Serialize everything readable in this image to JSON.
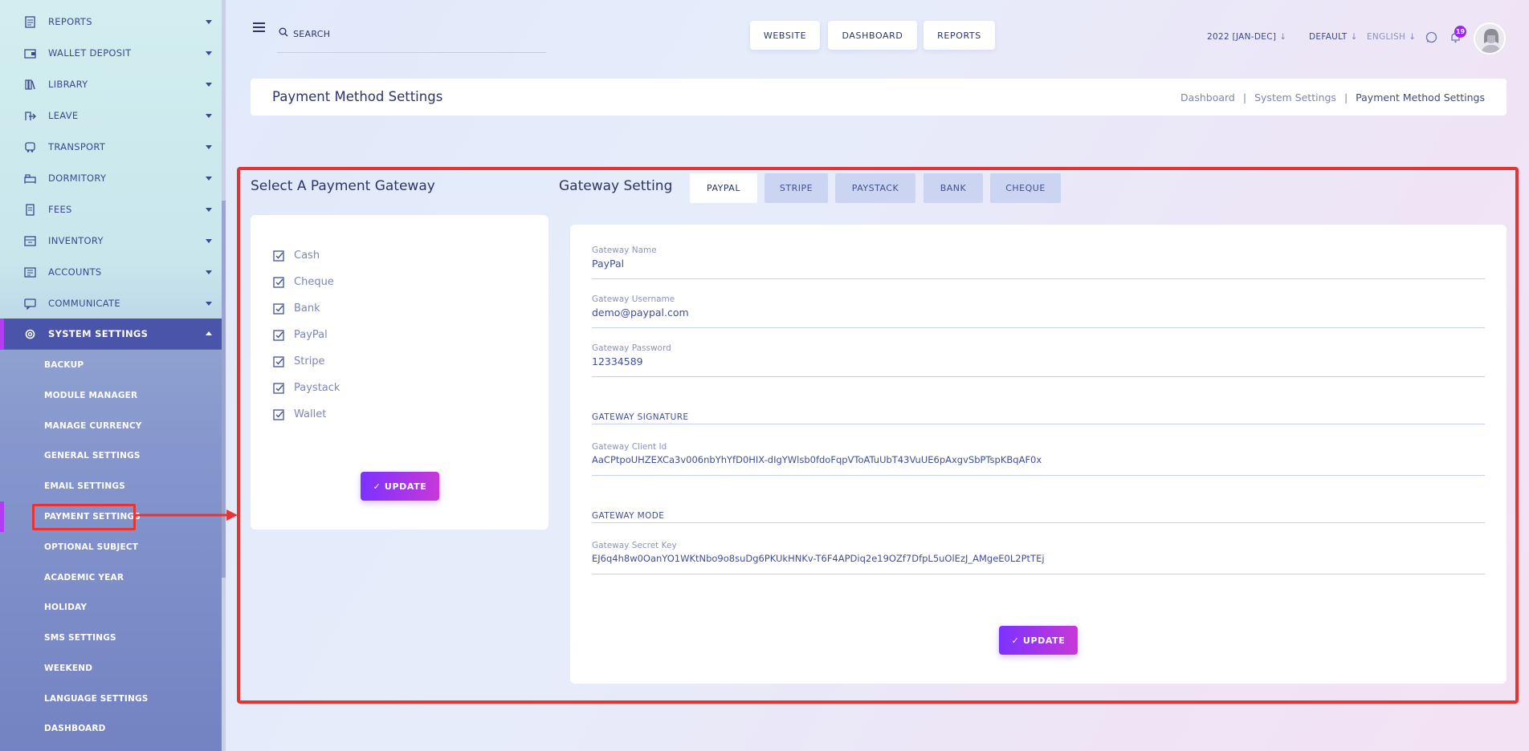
{
  "sidebar": {
    "items": [
      {
        "label": "REPORTS",
        "icon": "report-icon"
      },
      {
        "label": "WALLET DEPOSIT",
        "icon": "wallet-icon"
      },
      {
        "label": "LIBRARY",
        "icon": "library-icon"
      },
      {
        "label": "LEAVE",
        "icon": "leave-icon"
      },
      {
        "label": "TRANSPORT",
        "icon": "transport-icon"
      },
      {
        "label": "DORMITORY",
        "icon": "dormitory-icon"
      },
      {
        "label": "FEES",
        "icon": "fees-icon"
      },
      {
        "label": "INVENTORY",
        "icon": "inventory-icon"
      },
      {
        "label": "ACCOUNTS",
        "icon": "accounts-icon"
      },
      {
        "label": "COMMUNICATE",
        "icon": "communicate-icon"
      },
      {
        "label": "SYSTEM SETTINGS",
        "icon": "gear-icon"
      }
    ],
    "submenu": [
      "BACKUP",
      "MODULE MANAGER",
      "MANAGE CURRENCY",
      "GENERAL SETTINGS",
      "EMAIL SETTINGS",
      "PAYMENT SETTINGS",
      "OPTIONAL SUBJECT",
      "ACADEMIC YEAR",
      "HOLIDAY",
      "SMS SETTINGS",
      "WEEKEND",
      "LANGUAGE SETTINGS",
      "DASHBOARD"
    ],
    "active_submenu": "PAYMENT SETTINGS"
  },
  "topbar": {
    "search_placeholder": "SEARCH",
    "buttons": [
      "WEBSITE",
      "DASHBOARD",
      "REPORTS"
    ],
    "session": "2022 [JAN-DEC]",
    "style": "DEFAULT",
    "language": "ENGLISH",
    "notification_count": "19"
  },
  "page_header": {
    "title": "Payment Method Settings",
    "breadcrumb": [
      "Dashboard",
      "System Settings",
      "Payment Method Settings"
    ]
  },
  "select_gateway": {
    "title": "Select A Payment Gateway",
    "options": [
      "Cash",
      "Cheque",
      "Bank",
      "PayPal",
      "Stripe",
      "Paystack",
      "Wallet"
    ],
    "update_label": "✓ UPDATE"
  },
  "gateway_setting": {
    "title": "Gateway Setting",
    "tabs": [
      "PAYPAL",
      "STRIPE",
      "PAYSTACK",
      "BANK",
      "CHEQUE"
    ],
    "active_tab": "PAYPAL",
    "fields": {
      "name": {
        "label": "Gateway Name",
        "value": "PayPal"
      },
      "username": {
        "label": "Gateway Username",
        "value": "demo@paypal.com"
      },
      "password": {
        "label": "Gateway Password",
        "value": "12334589"
      },
      "signature_head": "GATEWAY SIGNATURE",
      "client_id": {
        "label": "Gateway Client Id",
        "value": "AaCPtpoUHZEXCa3v006nbYhYfD0HIX-dIgYWlsb0fdoFqpVToATuUbT43VuUE6pAxgvSbPTspKBqAF0x"
      },
      "mode_head": "GATEWAY MODE",
      "secret_key": {
        "label": "Gateway Secret Key",
        "value": "EJ6q4h8w0OanYO1WKtNbo9o8suDg6PKUkHNKv-T6F4APDiq2e19OZf7DfpL5uOlEzJ_AMgeE0L2PtTEj"
      }
    },
    "update_label": "✓ UPDATE"
  },
  "colors": {
    "accent_start": "#7c32ff",
    "accent_end": "#c738d8",
    "highlight": "#e53434",
    "sidebar_active": "#4a54a8"
  }
}
